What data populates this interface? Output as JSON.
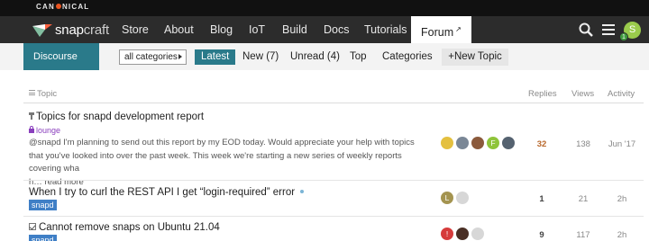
{
  "canonical": {
    "brand": "CAN·NICAL",
    "brand_left": "CAN",
    "brand_right": "NICAL"
  },
  "nav": {
    "logo_a": "snap",
    "logo_b": "craft",
    "items": [
      "Store",
      "About",
      "Blog",
      "IoT",
      "Build",
      "Docs",
      "Tutorials"
    ],
    "active": "Forum",
    "avatar_letter": "S",
    "notification_count": "1"
  },
  "subbar": {
    "discourse": "Discourse",
    "category_select": "all categories",
    "tabs": [
      "Latest",
      "New (7)",
      "Unread (4)",
      "Top",
      "Categories"
    ],
    "new_topic": "New Topic"
  },
  "columns": {
    "topic": "Topic",
    "replies": "Replies",
    "views": "Views",
    "activity": "Activity"
  },
  "topics": [
    {
      "title": "Topics for snapd development report",
      "category": "lounge",
      "excerpt": "@snapd I'm planning to send out this report by my EOD today. Would appreciate your help with topics that you've looked into over the past week. This week we're starting a new series of weekly reports covering wha",
      "excerpt_tail": "h…",
      "read_more": "read more",
      "replies": "32",
      "views": "138",
      "activity": "Jun '17"
    },
    {
      "title": "When I try to curl the REST API I get “login-required” error",
      "category": "snapd",
      "replies": "1",
      "views": "21",
      "activity": "2h"
    },
    {
      "title": "Cannot remove snaps on Ubuntu 21.04",
      "category": "snapd",
      "replies": "9",
      "views": "117",
      "activity": "2h"
    }
  ],
  "avatars": {
    "row1": [
      "",
      "",
      "",
      "F",
      ""
    ],
    "row2": [
      "L",
      ""
    ],
    "row3": [
      "!",
      "",
      ""
    ]
  },
  "colors": {
    "nav_bg": "#2c2c2c",
    "accent_teal": "#2a7a8a",
    "snapd_badge": "#3f7fc6",
    "lounge": "#8a3fbd",
    "hot_replies": "#b8672a"
  },
  "icons": {
    "search": "search-icon",
    "menu": "hamburger-icon",
    "pin": "pin-icon",
    "solved": "check-icon",
    "lock": "lock-icon",
    "external": "external-link-icon"
  }
}
